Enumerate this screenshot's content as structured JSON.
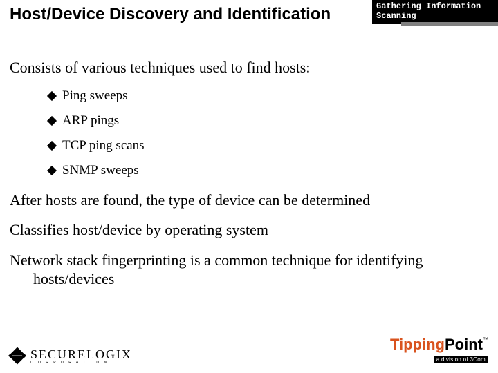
{
  "topic": {
    "line1": "Gathering Information",
    "line2": "Scanning"
  },
  "title": "Host/Device Discovery and Identification",
  "body": {
    "intro": "Consists of various techniques used to find hosts:",
    "bullets": [
      "Ping sweeps",
      "ARP pings",
      "TCP ping scans",
      "SNMP sweeps"
    ],
    "p2": "After hosts are found, the type of device can be determined",
    "p3": "Classifies host/device by operating system",
    "p4": "Network stack fingerprinting is a common technique for identifying hosts/devices"
  },
  "logos": {
    "left_name": "SecureLogix",
    "left_name_prefix": "S",
    "left_name_rest": "ECURE",
    "left_name_prefix2": "L",
    "left_name_rest2": "OGIX",
    "left_sub": "C O R P O R A T I O N",
    "right_part1": "Tipping",
    "right_part2": "Point",
    "right_tm": "™",
    "right_sub": "a division of 3Com"
  }
}
